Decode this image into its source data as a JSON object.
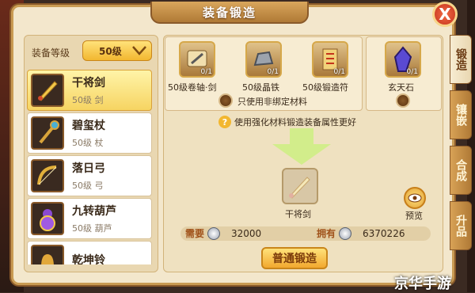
{
  "title": "装备锻造",
  "close_label": "X",
  "filter": {
    "label": "装备等级",
    "selected": "50级"
  },
  "items": [
    {
      "name": "干将剑",
      "sub": "50级 剑"
    },
    {
      "name": "碧玺杖",
      "sub": "50级 杖"
    },
    {
      "name": "落日弓",
      "sub": "50级 弓"
    },
    {
      "name": "九转葫芦",
      "sub": "50级 葫芦"
    },
    {
      "name": "乾坤铃",
      "sub": ""
    }
  ],
  "materials": [
    {
      "name": "50级卷轴·剑",
      "count": "0/1"
    },
    {
      "name": "50级晶铁",
      "count": "0/1"
    },
    {
      "name": "50级锻造符",
      "count": "0/1"
    }
  ],
  "nonbound_label": "只使用非绑定材料",
  "extra_material": {
    "name": "玄天石",
    "count": "0/1"
  },
  "hint": "使用强化材料锻造装备属性更好",
  "target_label": "干将剑",
  "preview_label": "预览",
  "cost": {
    "need_label": "需要",
    "need_value": "32000",
    "have_label": "拥有",
    "have_value": "6370226"
  },
  "forge_button": "普通锻造",
  "tabs": [
    "锻造",
    "镶嵌",
    "合成",
    "升品"
  ],
  "watermark": "京华手游"
}
